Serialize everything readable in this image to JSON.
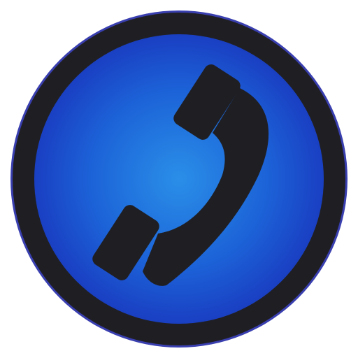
{
  "icon": {
    "semantic": "phone-icon",
    "colors": {
      "background": "#ffffff",
      "outer_edge": "#3a3fb0",
      "ring": "#1f1f23",
      "disc_center": "#2a8fe8",
      "disc_mid": "#1c63d8",
      "disc_edge": "#1a3fc2",
      "handset": "#1f1f23"
    }
  }
}
